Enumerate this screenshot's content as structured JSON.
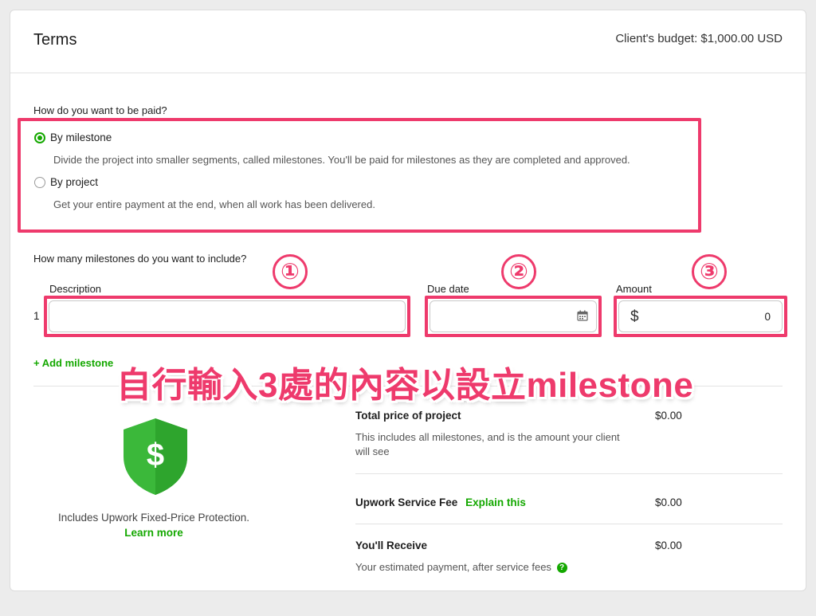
{
  "header": {
    "title": "Terms",
    "budget": "Client's budget: $1,000.00 USD"
  },
  "payment": {
    "question": "How do you want to be paid?",
    "options": [
      {
        "label": "By milestone",
        "description": "Divide the project into smaller segments, called milestones. You'll be paid for milestones as they are completed and approved.",
        "selected": true
      },
      {
        "label": "By project",
        "description": "Get your entire payment at the end, when all work has been delivered.",
        "selected": false
      }
    ]
  },
  "milestones": {
    "question": "How many milestones do you want to include?",
    "columns": {
      "description": "Description",
      "due_date": "Due date",
      "amount": "Amount"
    },
    "rows": [
      {
        "index": "1",
        "description": "",
        "due_date": "",
        "currency": "$",
        "amount": "0"
      }
    ],
    "add_label": "+ Add milestone"
  },
  "annotations": {
    "markers": [
      "①",
      "②",
      "③"
    ],
    "caption": "自行輸入3處的內容以設立milestone",
    "color": "#ee3a6c"
  },
  "protection": {
    "shield_symbol": "$",
    "text": "Includes Upwork Fixed-Price Protection.",
    "link": "Learn more",
    "icon": "shield-dollar-icon"
  },
  "summary": {
    "total": {
      "title": "Total price of project",
      "description": "This includes all milestones, and is the amount your client will see",
      "amount": "$0.00"
    },
    "fee": {
      "title": "Upwork Service Fee",
      "link": "Explain this",
      "amount": "$0.00"
    },
    "receive": {
      "title": "You'll Receive",
      "description": "Your estimated payment, after service fees",
      "help_symbol": "?",
      "amount": "$0.00"
    }
  },
  "colors": {
    "brand_green": "#14a800",
    "annotation_pink": "#ee3a6c"
  }
}
